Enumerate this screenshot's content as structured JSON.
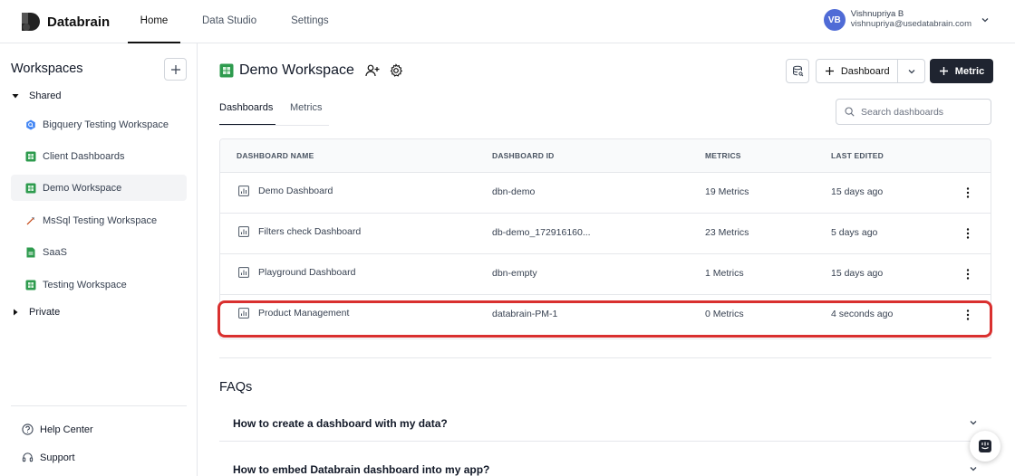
{
  "app": {
    "name": "Databrain"
  },
  "topnav": {
    "items": [
      "Home",
      "Data Studio",
      "Settings"
    ]
  },
  "user": {
    "initials": "VB",
    "name": "Vishnupriya B",
    "email": "vishnupriya@usedatabrain.com"
  },
  "sidebar": {
    "title": "Workspaces",
    "shared_label": "Shared",
    "private_label": "Private",
    "items": [
      {
        "label": "Bigquery Testing Workspace",
        "icon": "bigquery-icon"
      },
      {
        "label": "Client Dashboards",
        "icon": "sheet-icon"
      },
      {
        "label": "Demo Workspace",
        "icon": "sheet-icon",
        "active": true
      },
      {
        "label": "MsSql Testing Workspace",
        "icon": "mssql-icon"
      },
      {
        "label": "SaaS",
        "icon": "file-icon"
      },
      {
        "label": "Testing Workspace",
        "icon": "sheet-icon"
      }
    ],
    "help_label": "Help Center",
    "support_label": "Support"
  },
  "workspace": {
    "name": "Demo Workspace",
    "dashboard_button": "Dashboard",
    "metric_button": "Metric"
  },
  "tabs": [
    "Dashboards",
    "Metrics"
  ],
  "search": {
    "placeholder": "Search dashboards"
  },
  "table": {
    "headers": [
      "DASHBOARD NAME",
      "DASHBOARD ID",
      "METRICS",
      "LAST EDITED"
    ],
    "rows": [
      {
        "name": "Demo Dashboard",
        "id": "dbn-demo",
        "metrics": "19 Metrics",
        "edited": "15 days ago"
      },
      {
        "name": "Filters check Dashboard",
        "id": "db-demo_172916160...",
        "metrics": "23 Metrics",
        "edited": "5 days ago"
      },
      {
        "name": "Playground Dashboard",
        "id": "dbn-empty",
        "metrics": "1 Metrics",
        "edited": "15 days ago"
      },
      {
        "name": "Product Management",
        "id": "databrain-PM-1",
        "metrics": "0 Metrics",
        "edited": "4 seconds ago"
      }
    ]
  },
  "faq": {
    "title": "FAQs",
    "items": [
      "How to create a dashboard with my data?",
      "How to embed Databrain dashboard into my app?"
    ]
  },
  "colors": {
    "accent": "#1f2430",
    "avatar": "#4f6bd6",
    "highlight": "#d9302f",
    "sheet_green": "#2e9b4e"
  }
}
